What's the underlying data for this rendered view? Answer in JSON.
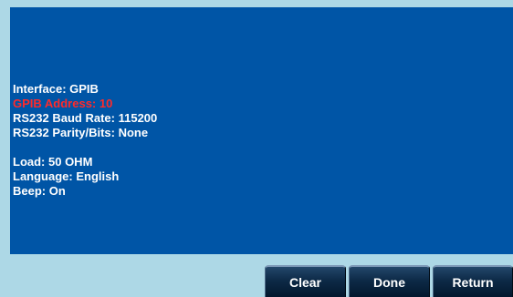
{
  "info_lines": [
    "Interface: GPIB",
    "GPIB Address: 10",
    "RS232 Baud Rate: 115200",
    "RS232 Parity/Bits: None",
    "Load: 50 OHM",
    "Language: English",
    "Beep: On"
  ],
  "selected_line_color": "#ff2a2a",
  "screen_color": "#0055a6",
  "frame_color": "#add8e6",
  "softkeys": {
    "clear": "Clear",
    "done": "Done",
    "return": "Return"
  }
}
